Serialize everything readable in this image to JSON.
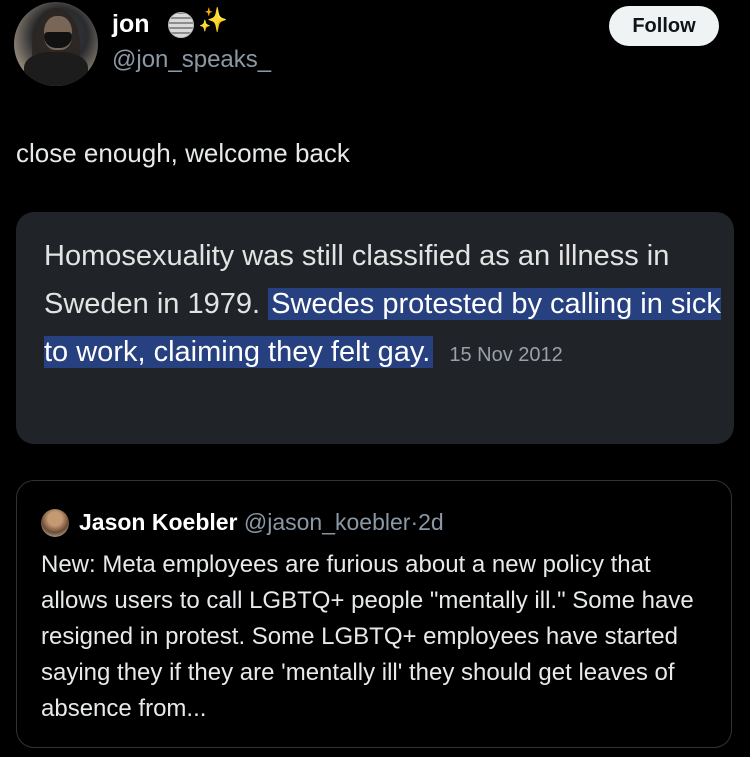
{
  "author": {
    "display_name": "jon",
    "handle": "@jon_speaks_",
    "badge_icons": [
      "globe-emoji-icon",
      "sparkles-emoji-icon"
    ],
    "sparkles_glyph": "✨"
  },
  "follow_label": "Follow",
  "tweet_text": "close enough, welcome back",
  "media": {
    "text_plain": "Homosexuality was still classified as an illness in Sweden in 1979.",
    "text_highlighted": "Swedes protested by calling in sick to work, claiming they felt gay.",
    "highlight_color": "#27407f",
    "date": "15 Nov 2012"
  },
  "quote": {
    "name": "Jason Koebler",
    "handle": "@jason_koebler",
    "separator": "·",
    "time": "2d",
    "text": "New: Meta employees are furious about a new policy that allows users to call LGBTQ+ people \"mentally ill.\" Some have resigned in protest. Some LGBTQ+ employees have started saying they if they are 'mentally ill' they should get leaves of absence from..."
  },
  "colors": {
    "background": "#000000",
    "card": "#202327",
    "muted_text": "#8b98a5",
    "follow_bg": "#eff3f4"
  }
}
